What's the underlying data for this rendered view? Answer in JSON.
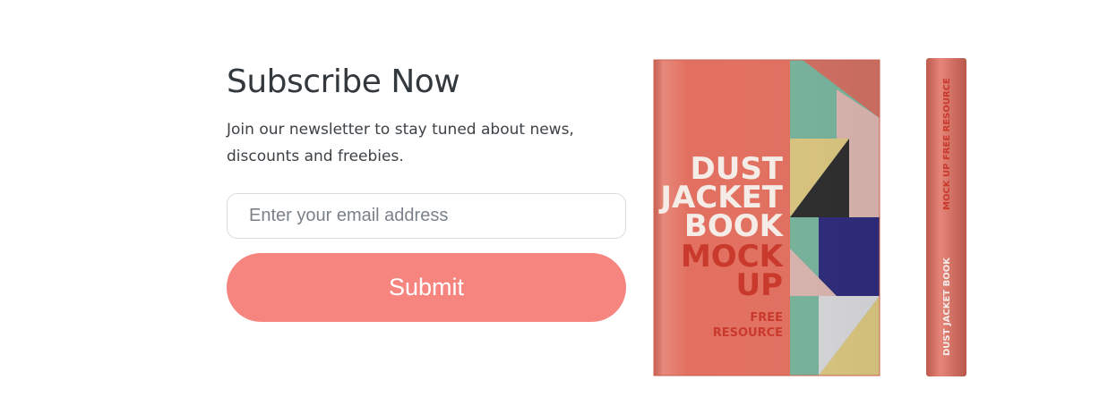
{
  "subscribe": {
    "title": "Subscribe Now",
    "description": "Join our newsletter to stay tuned about news, discounts and freebies.",
    "email_placeholder": "Enter your email address",
    "email_value": "",
    "submit_label": "Submit"
  },
  "book_mockup": {
    "cover_lines": [
      "DUST",
      "JACKET",
      "BOOK"
    ],
    "cover_accent_lines": [
      "MOCK",
      "UP"
    ],
    "cover_footer_lines": [
      "FREE",
      "RESOURCE"
    ],
    "spine_text_top": "MOCK UP FREE RESOURCE",
    "spine_text_bottom": "DUST JACKET BOOK",
    "colors": {
      "cover": "#e27060",
      "accent_text": "#c9392c",
      "light_text": "#f5ece8",
      "teal": "#78b39c",
      "sand": "#d9c57f",
      "navy": "#2e2c7a",
      "pink": "#d9b4ae",
      "dark": "#2e2e2e"
    }
  },
  "button_color": "#f7857f"
}
